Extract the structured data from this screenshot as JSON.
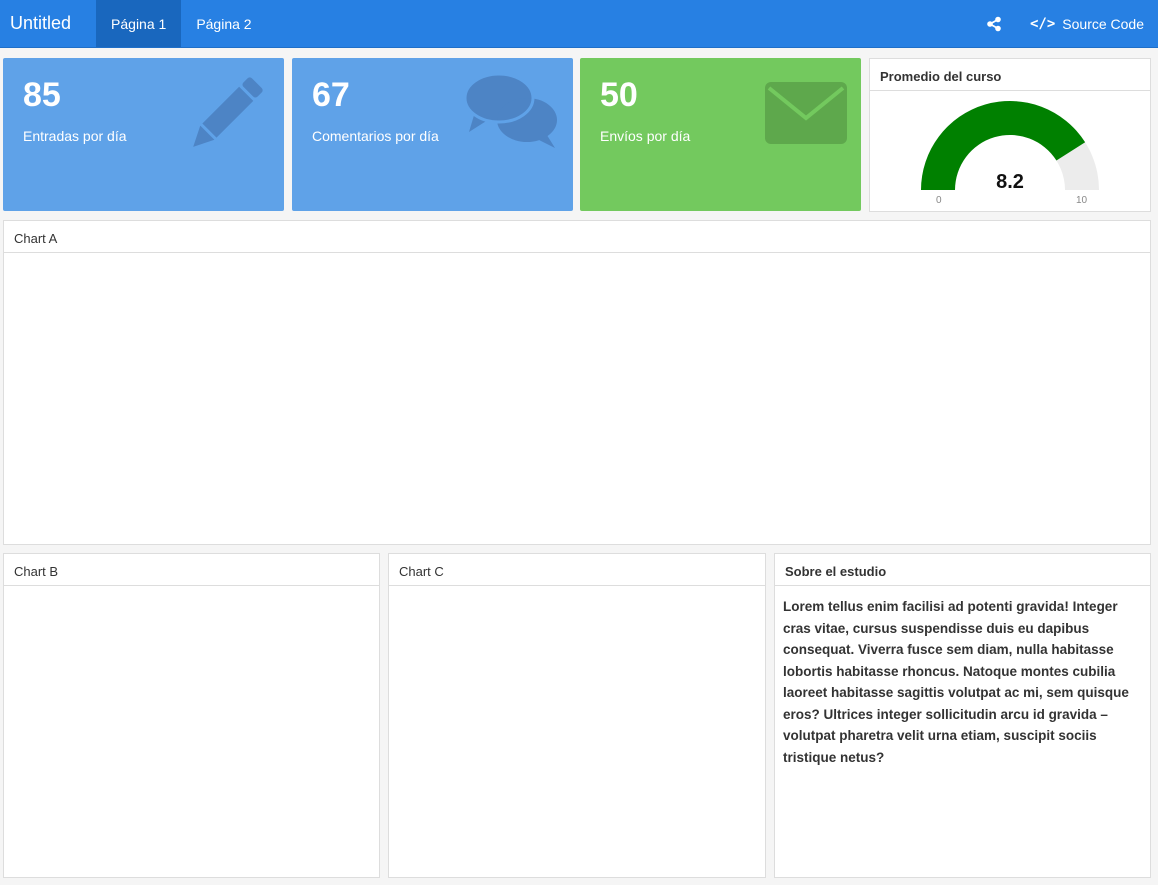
{
  "navbar": {
    "title": "Untitled",
    "tabs": [
      {
        "label": "Página 1",
        "active": true
      },
      {
        "label": "Página 2",
        "active": false
      }
    ],
    "source_code_label": "Source Code",
    "share_icon": "share-icon",
    "code_icon": "code-icon"
  },
  "value_boxes": [
    {
      "value": "85",
      "caption": "Entradas por día",
      "icon": "pencil-icon",
      "color": "#5fa2e8"
    },
    {
      "value": "67",
      "caption": "Comentarios por día",
      "icon": "comments-icon",
      "color": "#5fa2e8"
    },
    {
      "value": "50",
      "caption": "Envíos por día",
      "icon": "envelope-icon",
      "color": "#73c95e"
    }
  ],
  "gauge": {
    "title": "Promedio del curso",
    "value": 8.2,
    "value_label": "8.2",
    "min": 0,
    "max": 10,
    "min_label": "0",
    "max_label": "10",
    "fill_color": "#008000",
    "track_color": "#ececec"
  },
  "charts": {
    "a_title": "Chart A",
    "b_title": "Chart B",
    "c_title": "Chart C"
  },
  "about": {
    "title": "Sobre el estudio",
    "text": "Lorem tellus enim facilisi ad potenti gravida! Integer cras vitae, cursus suspendisse duis eu dapibus consequat. Viverra fusce sem diam, nulla habitasse lobortis habitasse rhoncus. Natoque montes cubilia laoreet habitasse sagittis volutpat ac mi, sem quisque eros? Ultrices integer sollicitudin arcu id gravida – volutpat pharetra velit urna etiam, suscipit sociis tristique netus?"
  }
}
